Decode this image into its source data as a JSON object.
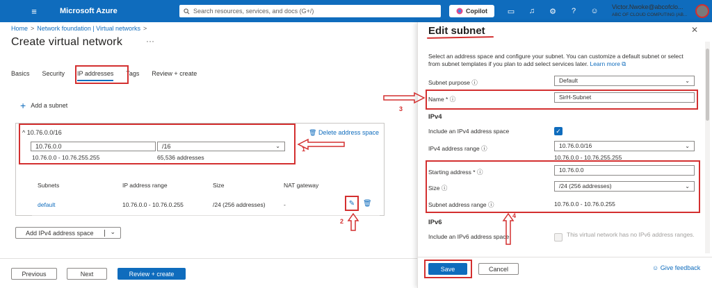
{
  "topbar": {
    "brand": "Microsoft Azure",
    "search_placeholder": "Search resources, services, and docs (G+/)",
    "copilot_label": "Copilot",
    "user_name": "Victor.Nwoke@abcofclo...",
    "user_dir": "ABC OF CLOUD COMPUTING (AB..."
  },
  "breadcrumb": {
    "home": "Home",
    "sep1": ">",
    "parent": "Network foundation | Virtual networks",
    "sep2": ">"
  },
  "page": {
    "title": "Create virtual network",
    "more": "···"
  },
  "tabs": [
    "Basics",
    "Security",
    "IP addresses",
    "Tags",
    "Review + create"
  ],
  "ip": {
    "add_subnet": "Add a subnet",
    "space_label": "10.76.0.0/16",
    "delete_space": "Delete address space",
    "address_value": "10.76.0.0",
    "mask_value": "/16",
    "range_text": "10.76.0.0 - 10.76.255.255",
    "count_text": "65,536 addresses",
    "table": {
      "headers": [
        "Subnets",
        "IP address range",
        "Size",
        "NAT gateway"
      ],
      "rows": [
        {
          "name": "default",
          "range": "10.76.0.0 - 10.76.0.255",
          "size": "/24 (256 addresses)",
          "nat": "-"
        }
      ]
    },
    "add_ipv4": "Add IPv4 address space"
  },
  "footer": {
    "previous": "Previous",
    "next": "Next",
    "review": "Review + create"
  },
  "annotations": {
    "a1": "1",
    "a2": "2",
    "a3": "3",
    "a4": "4"
  },
  "panel": {
    "title": "Edit subnet",
    "description": "Select an address space and configure your subnet. You can customize a default subnet or select from subnet templates if you plan to add select services later.",
    "learn_more": "Learn more",
    "subnet_purpose_label": "Subnet purpose",
    "subnet_purpose_value": "Default",
    "name_label": "Name *",
    "name_value": "SirH-Subnet",
    "ipv4_heading": "IPv4",
    "include_ipv4_label": "Include an IPv4 address space",
    "ipv4_range_label": "IPv4 address range",
    "ipv4_range_value": "10.76.0.0/16",
    "ipv4_range_hint": "10.76.0.0 - 10.76.255.255",
    "starting_label": "Starting address *",
    "starting_value": "10.76.0.0",
    "size_label": "Size",
    "size_value": "/24 (256 addresses)",
    "subnet_range_label": "Subnet address range",
    "subnet_range_value": "10.76.0.0 - 10.76.0.255",
    "ipv6_heading": "IPv6",
    "include_ipv6_label": "Include an IPv6 address space",
    "ipv6_disabled_text": "This virtual network has no IPv6 address ranges.",
    "save": "Save",
    "cancel": "Cancel",
    "feedback": "Give feedback"
  },
  "colors": {
    "accent": "#0f6cbd",
    "annotation_red": "#d32f2f"
  }
}
